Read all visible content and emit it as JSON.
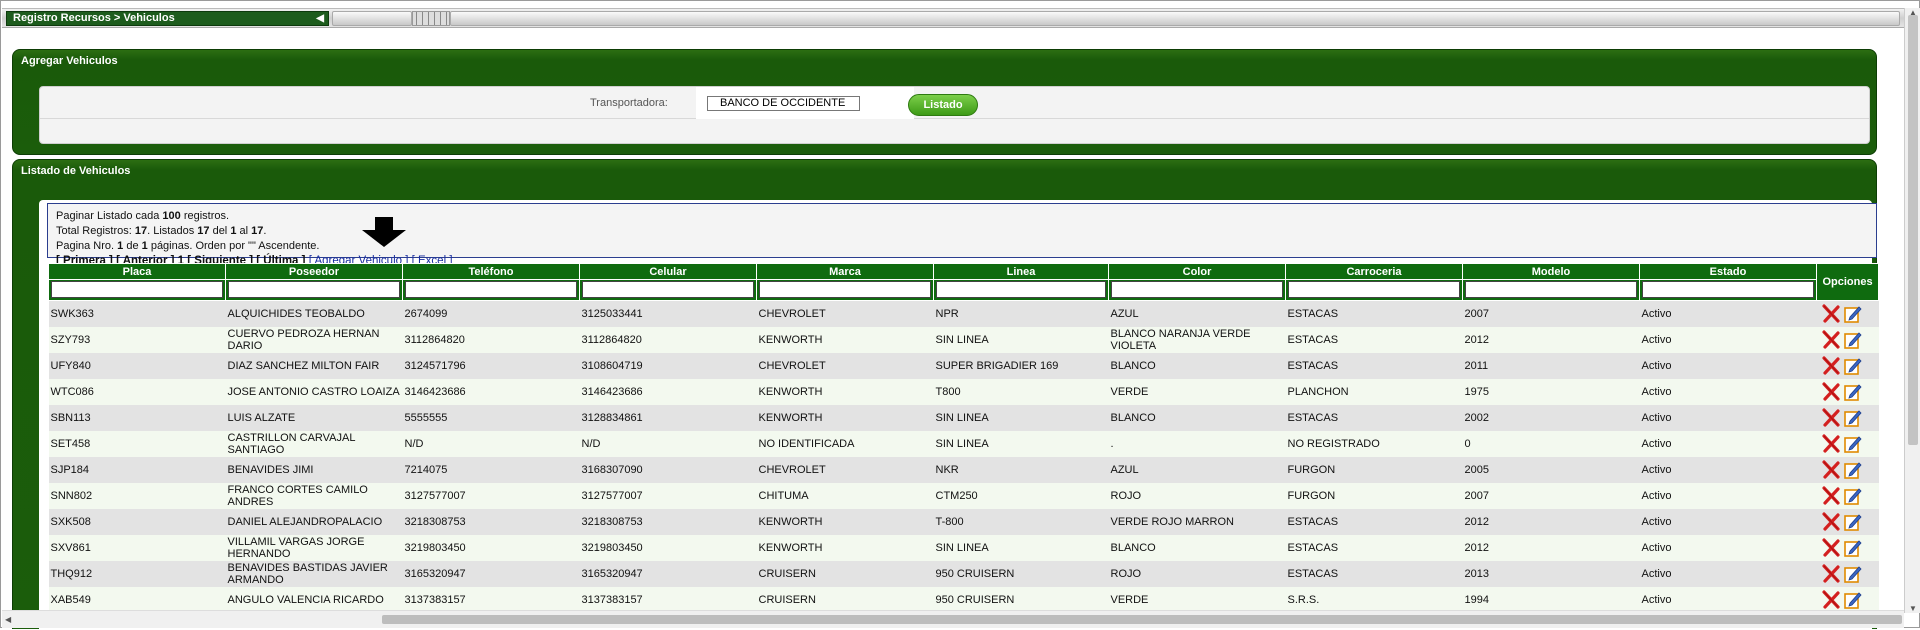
{
  "breadcrumb": "Registro Recursos > Vehiculos",
  "agregar_panel": {
    "title": "Agregar Vehiculos",
    "transportadora_label": "Transportadora:",
    "transportadora_value": "BANCO DE OCCIDENTE",
    "listado_button": "Listado"
  },
  "listado_panel": {
    "title": "Listado de Vehiculos",
    "info": {
      "line1_a": "Paginar Listado cada ",
      "line1_b": "100",
      "line1_c": " registros.",
      "line2_a": "Total Registros: ",
      "line2_b": "17",
      "line2_c": ". Listados ",
      "line2_d": "17",
      "line2_e": " del ",
      "line2_f": "1",
      "line2_g": " al ",
      "line2_h": "17",
      "line2_i": ".",
      "line3_a": "Pagina Nro. ",
      "line3_b": "1",
      "line3_c": " de ",
      "line3_d": "1",
      "line3_e": " páginas. Orden por \"\" Ascendente.",
      "nav_primera": "[ Primera ]",
      "nav_anterior": "[ Anterior ]",
      "nav_page": "1",
      "nav_siguiente": "[ Siguiente ]",
      "nav_ultima": "[ Última ]",
      "nav_agregar": "[ Agregar Vehiculo ]",
      "nav_excel": "[ Excel ]"
    },
    "columns": [
      "Placa",
      "Poseedor",
      "Teléfono",
      "Celular",
      "Marca",
      "Linea",
      "Color",
      "Carroceria",
      "Modelo",
      "Estado",
      "Opciones"
    ],
    "rows": [
      [
        "SWK363",
        "ALQUICHIDES TEOBALDO",
        "2674099",
        "3125033441",
        "CHEVROLET",
        "NPR",
        "AZUL",
        "ESTACAS",
        "2007",
        "Activo"
      ],
      [
        "SZY793",
        "CUERVO PEDROZA HERNAN DARIO",
        "3112864820",
        "3112864820",
        "KENWORTH",
        "SIN LINEA",
        "BLANCO NARANJA VERDE VIOLETA",
        "ESTACAS",
        "2012",
        "Activo"
      ],
      [
        "UFY840",
        "DIAZ SANCHEZ MILTON FAIR",
        "3124571796",
        "3108604719",
        "CHEVROLET",
        "SUPER BRIGADIER 169",
        "BLANCO",
        "ESTACAS",
        "2011",
        "Activo"
      ],
      [
        "WTC086",
        "JOSE ANTONIO CASTRO LOAIZA",
        "3146423686",
        "3146423686",
        "KENWORTH",
        "T800",
        "VERDE",
        "PLANCHON",
        "1975",
        "Activo"
      ],
      [
        "SBN113",
        "LUIS ALZATE",
        "5555555",
        "3128834861",
        "KENWORTH",
        "SIN LINEA",
        "BLANCO",
        "ESTACAS",
        "2002",
        "Activo"
      ],
      [
        "SET458",
        "CASTRILLON CARVAJAL SANTIAGO",
        "N/D",
        "N/D",
        "NO IDENTIFICADA",
        "SIN LINEA",
        ".",
        "NO REGISTRADO",
        "0",
        "Activo"
      ],
      [
        "SJP184",
        "BENAVIDES JIMI",
        "7214075",
        "3168307090",
        "CHEVROLET",
        "NKR",
        "AZUL",
        "FURGON",
        "2005",
        "Activo"
      ],
      [
        "SNN802",
        "FRANCO CORTES CAMILO ANDRES",
        "3127577007",
        "3127577007",
        "CHITUMA",
        "CTM250",
        "ROJO",
        "FURGON",
        "2007",
        "Activo"
      ],
      [
        "SXK508",
        "DANIEL ALEJANDROPALACIO",
        "3218308753",
        "3218308753",
        "KENWORTH",
        "T-800",
        "VERDE ROJO MARRON",
        "ESTACAS",
        "2012",
        "Activo"
      ],
      [
        "SXV861",
        "VILLAMIL VARGAS JORGE HERNANDO",
        "3219803450",
        "3219803450",
        "KENWORTH",
        "SIN LINEA",
        "BLANCO",
        "ESTACAS",
        "2012",
        "Activo"
      ],
      [
        "THQ912",
        "BENAVIDES BASTIDAS JAVIER ARMANDO",
        "3165320947",
        "3165320947",
        "CRUISERN",
        "950 CRUISERN",
        "ROJO",
        "ESTACAS",
        "2013",
        "Activo"
      ],
      [
        "XAB549",
        "ANGULO VALENCIA RICARDO",
        "3137383157",
        "3137383157",
        "CRUISERN",
        "950 CRUISERN",
        "VERDE",
        "S.R.S.",
        "1994",
        "Activo"
      ]
    ]
  },
  "icons": {
    "delete": "delete-icon",
    "edit": "edit-icon"
  },
  "colors": {
    "panel_green": "#1b5d0b",
    "header_green": "#0f6b0f",
    "link_blue": "#1a2ea0",
    "button_green": "#5cb82f"
  }
}
